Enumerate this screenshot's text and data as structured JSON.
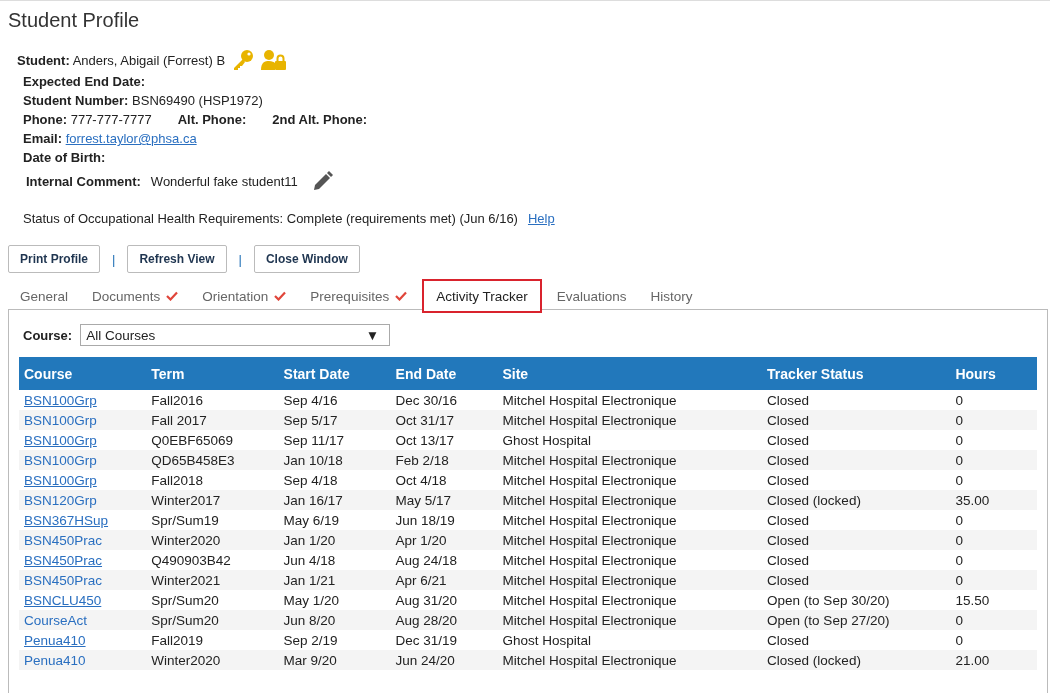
{
  "page_title": "Student Profile",
  "student": {
    "label": "Student:",
    "value": "Anders, Abigail (Forrest) B"
  },
  "fields": [
    {
      "kind": "plain",
      "items": [
        {
          "label": "Expected End Date:",
          "value": ""
        }
      ]
    },
    {
      "kind": "plain",
      "items": [
        {
          "label": "Student Number:",
          "value": "BSN69490  (HSP1972)"
        }
      ]
    },
    {
      "kind": "plain",
      "items": [
        {
          "label": "Phone:",
          "value": "777-777-7777"
        },
        {
          "label": "Alt. Phone:",
          "value": ""
        },
        {
          "label": "2nd Alt. Phone:",
          "value": ""
        }
      ]
    },
    {
      "kind": "link",
      "items": [
        {
          "label": "Email:",
          "value": "forrest.taylor@phsa.ca"
        }
      ]
    },
    {
      "kind": "plain",
      "items": [
        {
          "label": "Date of Birth:",
          "value": ""
        }
      ]
    },
    {
      "kind": "comment",
      "items": [
        {
          "label": "Internal Comment:",
          "value": "Wonderful fake student11"
        }
      ]
    }
  ],
  "status_line": {
    "text": "Status of Occupational Health Requirements: Complete (requirements met) (Jun 6/16)",
    "link": "Help"
  },
  "buttons": [
    "Print Profile",
    "Refresh View",
    "Close Window"
  ],
  "separator": "|",
  "tabs": [
    {
      "label": "General",
      "checked": false,
      "selected": false
    },
    {
      "label": "Documents",
      "checked": true,
      "selected": false
    },
    {
      "label": "Orientation",
      "checked": true,
      "selected": false
    },
    {
      "label": "Prerequisites",
      "checked": true,
      "selected": false
    },
    {
      "label": "Activity Tracker",
      "checked": false,
      "selected": true
    },
    {
      "label": "Evaluations",
      "checked": false,
      "selected": false
    },
    {
      "label": "History",
      "checked": false,
      "selected": false
    }
  ],
  "course_filter": {
    "label": "Course:",
    "value": "All Courses",
    "arrow": "▼"
  },
  "table": {
    "columns": [
      "Course",
      "Term",
      "Start Date",
      "End Date",
      "Site",
      "Tracker Status",
      "Hours"
    ],
    "rows": [
      {
        "cells": [
          "BSN100Grp",
          "Fall2016",
          "Sep 4/16",
          "Dec 30/16",
          "Mitchel Hospital Electronique",
          "Closed",
          "0"
        ],
        "underlined": true
      },
      {
        "cells": [
          "BSN100Grp",
          "Fall 2017",
          "Sep 5/17",
          "Oct 31/17",
          "Mitchel Hospital Electronique",
          "Closed",
          "0"
        ],
        "underlined": false
      },
      {
        "cells": [
          "BSN100Grp",
          "Q0EBF65069",
          "Sep 11/17",
          "Oct 13/17",
          "Ghost Hospital",
          "Closed",
          "0"
        ],
        "underlined": true
      },
      {
        "cells": [
          "BSN100Grp",
          "QD65B458E3",
          "Jan 10/18",
          "Feb 2/18",
          "Mitchel Hospital Electronique",
          "Closed",
          "0"
        ],
        "underlined": false
      },
      {
        "cells": [
          "BSN100Grp",
          "Fall2018",
          "Sep 4/18",
          "Oct 4/18",
          "Mitchel Hospital Electronique",
          "Closed",
          "0"
        ],
        "underlined": true
      },
      {
        "cells": [
          "BSN120Grp",
          "Winter2017",
          "Jan 16/17",
          "May 5/17",
          "Mitchel Hospital Electronique",
          "Closed (locked)",
          "35.00"
        ],
        "underlined": false
      },
      {
        "cells": [
          "BSN367HSup",
          "Spr/Sum19",
          "May 6/19",
          "Jun 18/19",
          "Mitchel Hospital Electronique",
          "Closed",
          "0"
        ],
        "underlined": true
      },
      {
        "cells": [
          "BSN450Prac",
          "Winter2020",
          "Jan 1/20",
          "Apr 1/20",
          "Mitchel Hospital Electronique",
          "Closed",
          "0"
        ],
        "underlined": false
      },
      {
        "cells": [
          "BSN450Prac",
          "Q490903B42",
          "Jun 4/18",
          "Aug 24/18",
          "Mitchel Hospital Electronique",
          "Closed",
          "0"
        ],
        "underlined": true
      },
      {
        "cells": [
          "BSN450Prac",
          "Winter2021",
          "Jan 1/21",
          "Apr 6/21",
          "Mitchel Hospital Electronique",
          "Closed",
          "0"
        ],
        "underlined": false
      },
      {
        "cells": [
          "BSNCLU450",
          "Spr/Sum20",
          "May 1/20",
          "Aug 31/20",
          "Mitchel Hospital Electronique",
          "Open (to Sep 30/20)",
          "15.50"
        ],
        "underlined": true
      },
      {
        "cells": [
          "CourseAct",
          "Spr/Sum20",
          "Jun 8/20",
          "Aug 28/20",
          "Mitchel Hospital Electronique",
          "Open (to Sep 27/20)",
          "0"
        ],
        "underlined": false
      },
      {
        "cells": [
          "Penua410",
          "Fall2019",
          "Sep 2/19",
          "Dec 31/19",
          "Ghost Hospital",
          "Closed",
          "0"
        ],
        "underlined": true
      },
      {
        "cells": [
          "Penua410",
          "Winter2020",
          "Mar 9/20",
          "Jun 24/20",
          "Mitchel Hospital Electronique",
          "Closed (locked)",
          "21.00"
        ],
        "underlined": false
      }
    ]
  }
}
